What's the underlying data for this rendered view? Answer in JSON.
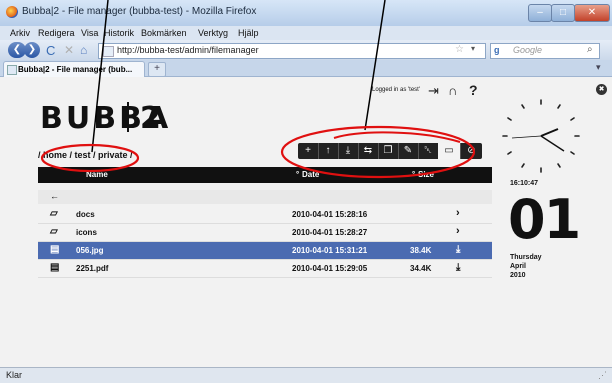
{
  "window": {
    "title": "Bubba|2 - File manager (bubba-test) - Mozilla Firefox",
    "controls": {
      "minimize": "–",
      "maximize": "□",
      "close": "✕"
    }
  },
  "menubar": [
    "Arkiv",
    "Redigera",
    "Visa",
    "Historik",
    "Bokmärken",
    "Verktyg",
    "Hjälp"
  ],
  "navigation": {
    "back": "❮",
    "forward": "❯",
    "reload": "C",
    "stop": "✕",
    "home": "⌂",
    "url": "http://bubba-test/admin/filemanager",
    "bookmark_star": "☆",
    "dropdown": "▾",
    "search_engine": "g",
    "search_placeholder": "Google",
    "search_icon": "⌕"
  },
  "tabs": {
    "active": "Bubba|2 - File manager (bub...",
    "new_tab": "+",
    "tab_list": "▾"
  },
  "status": {
    "text": "Klar",
    "grip": "⋰"
  },
  "header": {
    "logo_left": "BUBBA",
    "logo_right": "2",
    "logged_in": "Logged in as 'test'",
    "logout_icon": "⇥",
    "support_icon": "∩",
    "help_icon": "?",
    "close_icon": "✖"
  },
  "breadcrumb": "/ home / test / private /",
  "toolbar": [
    {
      "name": "new-folder",
      "glyph": "+"
    },
    {
      "name": "upload",
      "glyph": "↑"
    },
    {
      "name": "download",
      "glyph": "⤓"
    },
    {
      "name": "move",
      "glyph": "⇆"
    },
    {
      "name": "copy",
      "glyph": "❐"
    },
    {
      "name": "rename",
      "glyph": "✎"
    },
    {
      "name": "delete",
      "glyph": "␡"
    },
    {
      "name": "paste",
      "glyph": "▭"
    },
    {
      "name": "permissions",
      "glyph": "⊘"
    }
  ],
  "table": {
    "headers": {
      "name": "Name",
      "date": "Date",
      "size": "Size",
      "sort_marker": "°"
    },
    "up_glyph": "←",
    "rows": [
      {
        "icon": "folder-icon",
        "glyph": "▱",
        "name": "docs",
        "date": "2010-04-01 15:28:16",
        "size": "",
        "action": "›",
        "selected": false
      },
      {
        "icon": "folder-icon",
        "glyph": "▱",
        "name": "icons",
        "date": "2010-04-01 15:28:27",
        "size": "",
        "action": "›",
        "selected": false
      },
      {
        "icon": "file-icon",
        "glyph": "▤",
        "name": "056.jpg",
        "date": "2010-04-01 15:31:21",
        "size": "38.4K",
        "action": "⤓",
        "selected": true
      },
      {
        "icon": "file-icon",
        "glyph": "▤",
        "name": "2251.pdf",
        "date": "2010-04-01 15:29:05",
        "size": "34.4K",
        "action": "⤓",
        "selected": false
      }
    ]
  },
  "clock": {
    "time": "16:10:47",
    "day": "01",
    "weekday": "Thursday",
    "month": "April",
    "year": "2010"
  },
  "colors": {
    "selected_row": "#4b6bb1",
    "annotation": "#e01010",
    "toolbar": "#222222"
  }
}
